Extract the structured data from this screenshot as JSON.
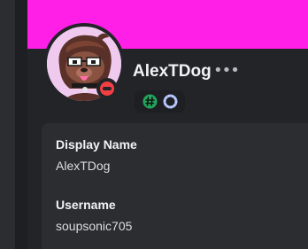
{
  "colors": {
    "banner": "#ff1fe6",
    "status_dnd": "#f23f43",
    "background": "#232428",
    "panel": "#2b2d31"
  },
  "profile": {
    "display_name_header": "AlexTDog",
    "more_icon": "•••",
    "status": "dnd",
    "badges": [
      {
        "icon": "hashtag-badge-icon"
      },
      {
        "icon": "nitro-ring-badge-icon"
      }
    ]
  },
  "fields": {
    "display_name_label": "Display Name",
    "display_name_value": "AlexTDog",
    "username_label": "Username",
    "username_value": "soupsonic705"
  }
}
